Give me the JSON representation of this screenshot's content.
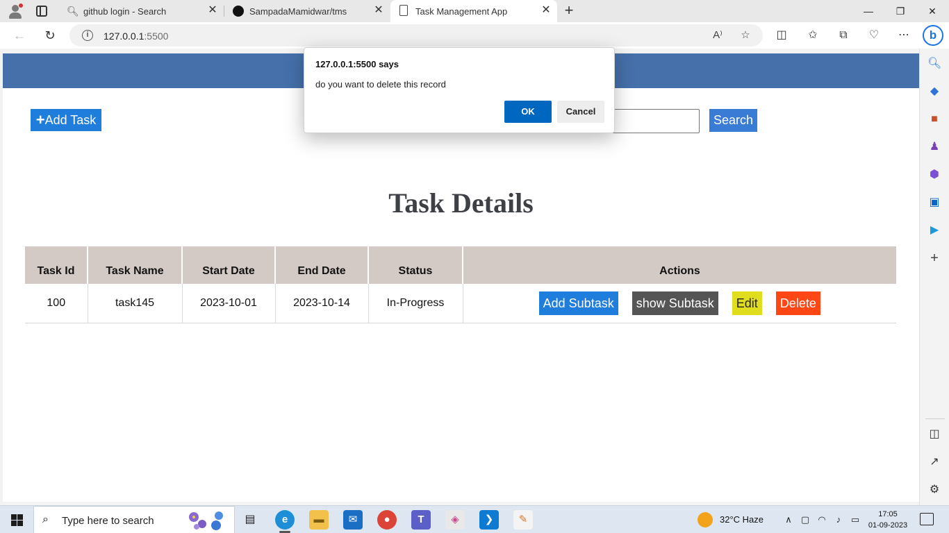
{
  "browser": {
    "tabs": [
      {
        "label": "github login - Search",
        "icon": "search-icon"
      },
      {
        "label": "SampadaMamidwar/tms",
        "icon": "github-icon"
      },
      {
        "label": "Task Management App",
        "icon": "page-icon"
      }
    ],
    "active_tab": 2,
    "url": {
      "host": "127.0.0.1",
      "port": ":5500"
    }
  },
  "app": {
    "add_task_label": "Add Task",
    "search_label": "Search",
    "search_value": "",
    "title": "Task Details",
    "header_color": "#4670aa",
    "table": {
      "columns": [
        "Task Id",
        "Task Name",
        "Start Date",
        "End Date",
        "Status",
        "Actions"
      ],
      "rows": [
        {
          "id": "100",
          "name": "task145",
          "start": "2023-10-01",
          "end": "2023-10-14",
          "status": "In-Progress"
        }
      ],
      "actions": {
        "add_subtask": "Add Subtask",
        "show_subtask": "show Subtask",
        "edit": "Edit",
        "delete": "Delete"
      }
    }
  },
  "dialog": {
    "title": "127.0.0.1:5500 says",
    "message": "do you want to delete this record",
    "ok": "OK",
    "cancel": "Cancel"
  },
  "taskbar": {
    "search_placeholder": "Type here to search",
    "weather": "32°C  Haze",
    "time": "17:05",
    "date": "01-09-2023"
  }
}
